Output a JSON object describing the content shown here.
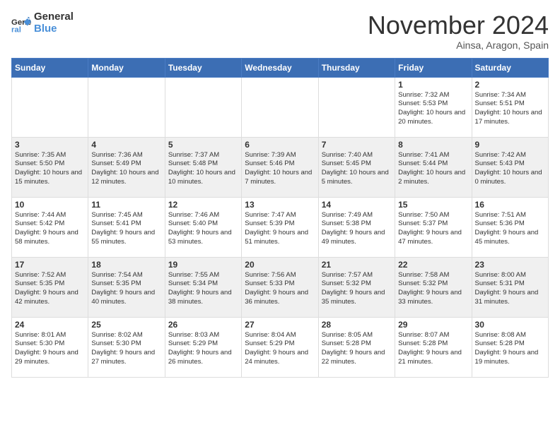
{
  "header": {
    "logo_line1": "General",
    "logo_line2": "Blue",
    "month": "November 2024",
    "location": "Ainsa, Aragon, Spain"
  },
  "weekdays": [
    "Sunday",
    "Monday",
    "Tuesday",
    "Wednesday",
    "Thursday",
    "Friday",
    "Saturday"
  ],
  "weeks": [
    {
      "gray": false,
      "days": [
        {
          "num": "",
          "info": ""
        },
        {
          "num": "",
          "info": ""
        },
        {
          "num": "",
          "info": ""
        },
        {
          "num": "",
          "info": ""
        },
        {
          "num": "",
          "info": ""
        },
        {
          "num": "1",
          "info": "Sunrise: 7:32 AM\nSunset: 5:53 PM\nDaylight: 10 hours\nand 20 minutes."
        },
        {
          "num": "2",
          "info": "Sunrise: 7:34 AM\nSunset: 5:51 PM\nDaylight: 10 hours\nand 17 minutes."
        }
      ]
    },
    {
      "gray": true,
      "days": [
        {
          "num": "3",
          "info": "Sunrise: 7:35 AM\nSunset: 5:50 PM\nDaylight: 10 hours\nand 15 minutes."
        },
        {
          "num": "4",
          "info": "Sunrise: 7:36 AM\nSunset: 5:49 PM\nDaylight: 10 hours\nand 12 minutes."
        },
        {
          "num": "5",
          "info": "Sunrise: 7:37 AM\nSunset: 5:48 PM\nDaylight: 10 hours\nand 10 minutes."
        },
        {
          "num": "6",
          "info": "Sunrise: 7:39 AM\nSunset: 5:46 PM\nDaylight: 10 hours\nand 7 minutes."
        },
        {
          "num": "7",
          "info": "Sunrise: 7:40 AM\nSunset: 5:45 PM\nDaylight: 10 hours\nand 5 minutes."
        },
        {
          "num": "8",
          "info": "Sunrise: 7:41 AM\nSunset: 5:44 PM\nDaylight: 10 hours\nand 2 minutes."
        },
        {
          "num": "9",
          "info": "Sunrise: 7:42 AM\nSunset: 5:43 PM\nDaylight: 10 hours\nand 0 minutes."
        }
      ]
    },
    {
      "gray": false,
      "days": [
        {
          "num": "10",
          "info": "Sunrise: 7:44 AM\nSunset: 5:42 PM\nDaylight: 9 hours\nand 58 minutes."
        },
        {
          "num": "11",
          "info": "Sunrise: 7:45 AM\nSunset: 5:41 PM\nDaylight: 9 hours\nand 55 minutes."
        },
        {
          "num": "12",
          "info": "Sunrise: 7:46 AM\nSunset: 5:40 PM\nDaylight: 9 hours\nand 53 minutes."
        },
        {
          "num": "13",
          "info": "Sunrise: 7:47 AM\nSunset: 5:39 PM\nDaylight: 9 hours\nand 51 minutes."
        },
        {
          "num": "14",
          "info": "Sunrise: 7:49 AM\nSunset: 5:38 PM\nDaylight: 9 hours\nand 49 minutes."
        },
        {
          "num": "15",
          "info": "Sunrise: 7:50 AM\nSunset: 5:37 PM\nDaylight: 9 hours\nand 47 minutes."
        },
        {
          "num": "16",
          "info": "Sunrise: 7:51 AM\nSunset: 5:36 PM\nDaylight: 9 hours\nand 45 minutes."
        }
      ]
    },
    {
      "gray": true,
      "days": [
        {
          "num": "17",
          "info": "Sunrise: 7:52 AM\nSunset: 5:35 PM\nDaylight: 9 hours\nand 42 minutes."
        },
        {
          "num": "18",
          "info": "Sunrise: 7:54 AM\nSunset: 5:35 PM\nDaylight: 9 hours\nand 40 minutes."
        },
        {
          "num": "19",
          "info": "Sunrise: 7:55 AM\nSunset: 5:34 PM\nDaylight: 9 hours\nand 38 minutes."
        },
        {
          "num": "20",
          "info": "Sunrise: 7:56 AM\nSunset: 5:33 PM\nDaylight: 9 hours\nand 36 minutes."
        },
        {
          "num": "21",
          "info": "Sunrise: 7:57 AM\nSunset: 5:32 PM\nDaylight: 9 hours\nand 35 minutes."
        },
        {
          "num": "22",
          "info": "Sunrise: 7:58 AM\nSunset: 5:32 PM\nDaylight: 9 hours\nand 33 minutes."
        },
        {
          "num": "23",
          "info": "Sunrise: 8:00 AM\nSunset: 5:31 PM\nDaylight: 9 hours\nand 31 minutes."
        }
      ]
    },
    {
      "gray": false,
      "days": [
        {
          "num": "24",
          "info": "Sunrise: 8:01 AM\nSunset: 5:30 PM\nDaylight: 9 hours\nand 29 minutes."
        },
        {
          "num": "25",
          "info": "Sunrise: 8:02 AM\nSunset: 5:30 PM\nDaylight: 9 hours\nand 27 minutes."
        },
        {
          "num": "26",
          "info": "Sunrise: 8:03 AM\nSunset: 5:29 PM\nDaylight: 9 hours\nand 26 minutes."
        },
        {
          "num": "27",
          "info": "Sunrise: 8:04 AM\nSunset: 5:29 PM\nDaylight: 9 hours\nand 24 minutes."
        },
        {
          "num": "28",
          "info": "Sunrise: 8:05 AM\nSunset: 5:28 PM\nDaylight: 9 hours\nand 22 minutes."
        },
        {
          "num": "29",
          "info": "Sunrise: 8:07 AM\nSunset: 5:28 PM\nDaylight: 9 hours\nand 21 minutes."
        },
        {
          "num": "30",
          "info": "Sunrise: 8:08 AM\nSunset: 5:28 PM\nDaylight: 9 hours\nand 19 minutes."
        }
      ]
    }
  ]
}
